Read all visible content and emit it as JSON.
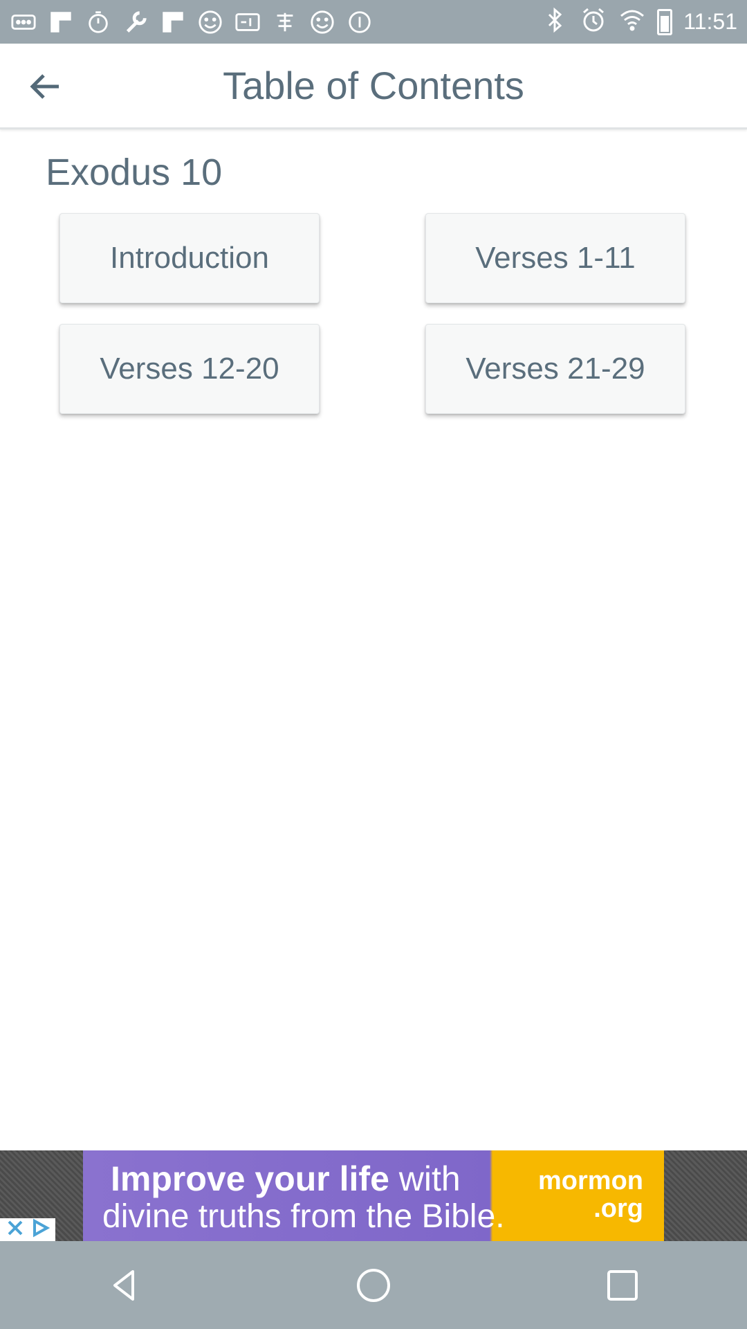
{
  "status_bar": {
    "time": "11:51",
    "left_icons": [
      "more-icon",
      "flipboard-icon",
      "timer-icon",
      "wrench-icon",
      "flipboard-icon",
      "smiley-icon",
      "qt-icon",
      "chinese-app-icon",
      "smiley-icon",
      "info-icon"
    ],
    "right_icons": [
      "bluetooth-icon",
      "alarm-icon",
      "wifi-icon",
      "battery-icon"
    ]
  },
  "app_bar": {
    "title": "Table of Contents",
    "back_icon": "back-arrow-icon"
  },
  "chapter": {
    "title": "Exodus 10",
    "sections": [
      {
        "label": "Introduction"
      },
      {
        "label": "Verses 1-11"
      },
      {
        "label": "Verses 12-20"
      },
      {
        "label": "Verses 21-29"
      }
    ]
  },
  "ad": {
    "line1_bold": "Improve your life",
    "line1_rest": " with",
    "line2": "divine truths from the Bible.",
    "brand_line1": "mormon",
    "brand_line2": ".org",
    "colors": {
      "purple": "#8a72cf",
      "yellow": "#f7b800"
    }
  },
  "nav_bar": {
    "buttons": [
      "back-triangle-icon",
      "home-circle-icon",
      "recents-square-icon"
    ]
  }
}
